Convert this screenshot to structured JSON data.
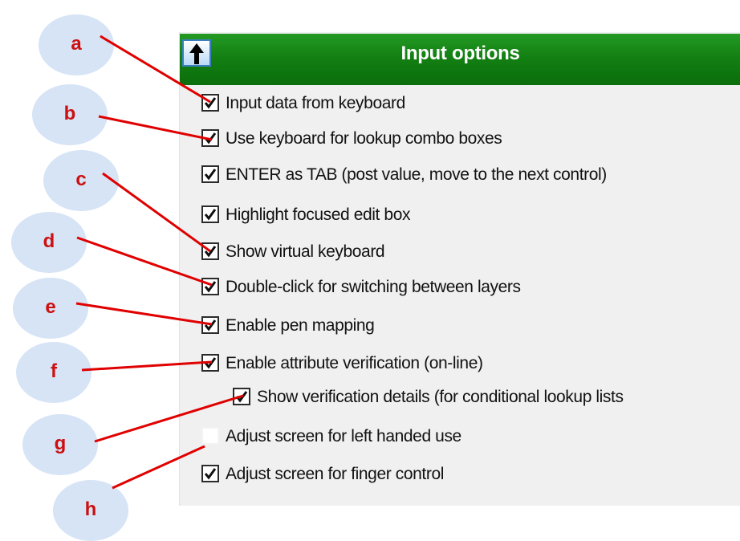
{
  "panel": {
    "title": "Input options",
    "up_button_icon": "up-arrow-icon"
  },
  "options": [
    {
      "id": "input-data-from-keyboard",
      "label": "Input data from keyboard",
      "checked": true
    },
    {
      "id": "use-keyboard-lookup",
      "label": "Use keyboard for lookup combo boxes",
      "checked": true
    },
    {
      "id": "enter-as-tab",
      "label": "ENTER as TAB (post value, move to the next control)",
      "checked": true
    },
    {
      "id": "highlight-focused-edit-box",
      "label": "Highlight focused edit box",
      "checked": true
    },
    {
      "id": "show-virtual-keyboard",
      "label": "Show virtual keyboard",
      "checked": true
    },
    {
      "id": "double-click-switching-layers",
      "label": "Double-click for switching between layers",
      "checked": true
    },
    {
      "id": "enable-pen-mapping",
      "label": "Enable pen mapping",
      "checked": true
    },
    {
      "id": "enable-attribute-verification",
      "label": "Enable attribute verification (on-line)",
      "checked": true
    },
    {
      "id": "show-verification-details",
      "label": "Show verification details (for conditional lookup lists",
      "checked": true
    },
    {
      "id": "adjust-left-handed",
      "label": "Adjust screen for left handed use",
      "checked": false
    },
    {
      "id": "adjust-finger-control",
      "label": "Adjust screen for finger control",
      "checked": true
    }
  ],
  "callouts": [
    {
      "letter": "a"
    },
    {
      "letter": "b"
    },
    {
      "letter": "c"
    },
    {
      "letter": "d"
    },
    {
      "letter": "e"
    },
    {
      "letter": "f"
    },
    {
      "letter": "g"
    },
    {
      "letter": "h"
    }
  ],
  "colors": {
    "header_green": "#138013",
    "callout_bubble": "#d6e4f6",
    "callout_text": "#cc1010",
    "leader_line": "#e00000"
  }
}
